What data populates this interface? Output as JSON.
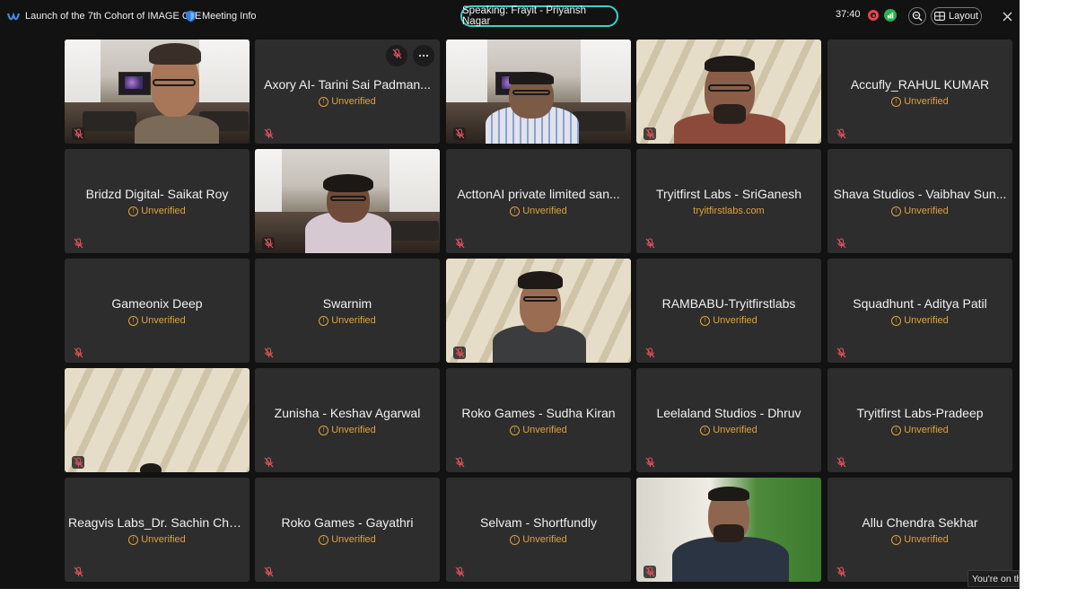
{
  "topbar": {
    "meeting_title": "Launch of the 7th Cohort of IMAGE CoE",
    "meeting_info": "Meeting Info",
    "speaking": "Speaking: Frayit - Priyansh Nagar",
    "timer": "37:40",
    "layout_label": "Layout"
  },
  "unverified_label": "Unverified",
  "tiles": [
    {
      "name": "",
      "sub": "",
      "video": true
    },
    {
      "name": "Axory AI- Tarini Sai Padman...",
      "sub": "Unverified",
      "video": false
    },
    {
      "name": "",
      "sub": "",
      "video": true
    },
    {
      "name": "",
      "sub": "",
      "video": true
    },
    {
      "name": "Accufly_RAHUL KUMAR",
      "sub": "Unverified",
      "video": false
    },
    {
      "name": "Bridzd Digital- Saikat Roy",
      "sub": "Unverified",
      "video": false
    },
    {
      "name": "",
      "sub": "",
      "video": true
    },
    {
      "name": "ActtonAI private limited san...",
      "sub": "Unverified",
      "video": false
    },
    {
      "name": "Tryitfirst Labs - SriGanesh",
      "sub": "tryitfirstlabs.com",
      "video": false
    },
    {
      "name": "Shava Studios - Vaibhav Sun...",
      "sub": "Unverified",
      "video": false
    },
    {
      "name": "Gameonix Deep",
      "sub": "Unverified",
      "video": false
    },
    {
      "name": "Swarnim",
      "sub": "Unverified",
      "video": false
    },
    {
      "name": "",
      "sub": "",
      "video": true
    },
    {
      "name": "RAMBABU-Tryitfirstlabs",
      "sub": "Unverified",
      "video": false
    },
    {
      "name": "Squadhunt - Aditya Patil",
      "sub": "Unverified",
      "video": false
    },
    {
      "name": "",
      "sub": "",
      "video": true
    },
    {
      "name": "Zunisha - Keshav Agarwal",
      "sub": "Unverified",
      "video": false
    },
    {
      "name": "Roko Games - Sudha Kiran",
      "sub": "Unverified",
      "video": false
    },
    {
      "name": "Leelaland Studios - Dhruv",
      "sub": "Unverified",
      "video": false
    },
    {
      "name": "Tryitfirst Labs-Pradeep",
      "sub": "Unverified",
      "video": false
    },
    {
      "name": "Reagvis Labs_Dr. Sachin Cha...",
      "sub": "Unverified",
      "video": false
    },
    {
      "name": "Roko Games - Gayathri",
      "sub": "Unverified",
      "video": false
    },
    {
      "name": "Selvam - Shortfundly",
      "sub": "Unverified",
      "video": false
    },
    {
      "name": "",
      "sub": "",
      "video": true
    },
    {
      "name": "Allu Chendra Sekhar",
      "sub": "Unverified",
      "video": false
    }
  ],
  "toast": "You're on th",
  "colors": {
    "background": "#121212",
    "tile": "#2d2d2d",
    "unverified": "#e0a23a",
    "speaking_border": "#3fd2c4",
    "record": "#e8434f"
  }
}
